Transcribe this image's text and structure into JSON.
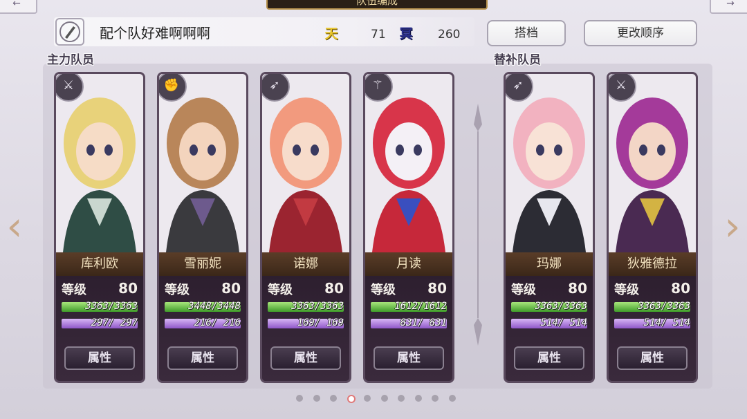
{
  "header": {
    "title": "队伍编成",
    "corner_left": "←",
    "corner_right": "→"
  },
  "team": {
    "name": "配个队好难啊啊啊"
  },
  "resources": [
    {
      "icon": "天",
      "value": "71"
    },
    {
      "icon": "冥",
      "value": "260"
    }
  ],
  "buttons": {
    "partner": "搭档",
    "reorder": "更改顺序"
  },
  "sections": {
    "main": "主力队员",
    "sub": "替补队员"
  },
  "level_label": "等级",
  "attr_label": "属性",
  "members": [
    {
      "name": "库利欧",
      "level": "80",
      "hp": "3363/3363",
      "mp": "297/ 297",
      "class_icon": "sword-icon",
      "class_glyph": "⚔",
      "hair": "#e8d27a",
      "skin": "#f6dcc6",
      "cloth": "#2f4d45",
      "accent": "#c9d7cf"
    },
    {
      "name": "雪丽妮",
      "level": "80",
      "hp": "3448/3448",
      "mp": "216/ 216",
      "class_icon": "gauntlet-icon",
      "class_glyph": "✊",
      "hair": "#b9865a",
      "skin": "#f3d4bd",
      "cloth": "#3a3a3e",
      "accent": "#6d5a8d"
    },
    {
      "name": "诺娜",
      "level": "80",
      "hp": "3363/3363",
      "mp": "169/ 169",
      "class_icon": "bow-icon",
      "class_glyph": "➶",
      "hair": "#f29a7e",
      "skin": "#f7dccb",
      "cloth": "#9b2430",
      "accent": "#c23a41"
    },
    {
      "name": "月读",
      "level": "80",
      "hp": "1612/1612",
      "mp": "831/ 831",
      "class_icon": "staff-icon",
      "class_glyph": "⚚",
      "hair": "#d8354a",
      "skin": "#f4f0f6",
      "cloth": "#c6283a",
      "accent": "#3a4fbf"
    },
    {
      "name": "玛娜",
      "level": "80",
      "hp": "3363/3363",
      "mp": "514/ 514",
      "class_icon": "bow-icon",
      "class_glyph": "➶",
      "hair": "#f2b2c0",
      "skin": "#f8e2d6",
      "cloth": "#2c2c34",
      "accent": "#e7e7ee"
    },
    {
      "name": "狄雅德拉",
      "level": "80",
      "hp": "3363/3363",
      "mp": "514/ 514",
      "class_icon": "sword-icon",
      "class_glyph": "⚔",
      "hair": "#a43a9a",
      "skin": "#f3d6c6",
      "cloth": "#4a2a52",
      "accent": "#d3b343"
    }
  ],
  "pagination": {
    "total": 10,
    "current": 4
  }
}
